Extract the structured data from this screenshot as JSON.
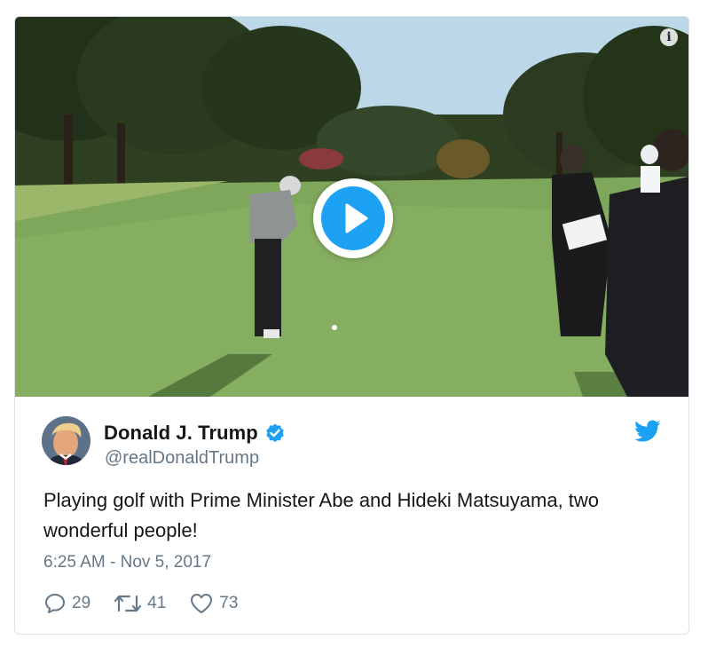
{
  "tweet": {
    "author": {
      "display_name": "Donald J. Trump",
      "handle": "@realDonaldTrump",
      "verified": true
    },
    "text": "Playing golf with Prime Minister Abe and Hideki Matsuyama, two wonderful people!",
    "timestamp": "6:25 AM - Nov 5, 2017",
    "stats": {
      "replies": "29",
      "retweets": "41",
      "likes": "73"
    }
  },
  "icons": {
    "play": "play-icon",
    "info": "info-icon",
    "verified": "verified-badge-icon",
    "brand": "twitter-bird-icon",
    "reply": "reply-icon",
    "retweet": "retweet-icon",
    "like": "heart-icon"
  },
  "colors": {
    "accent": "#1da1f2",
    "text": "#14171a",
    "secondary_text": "#657786",
    "border": "#dbe1e6"
  },
  "info_glyph": "i"
}
